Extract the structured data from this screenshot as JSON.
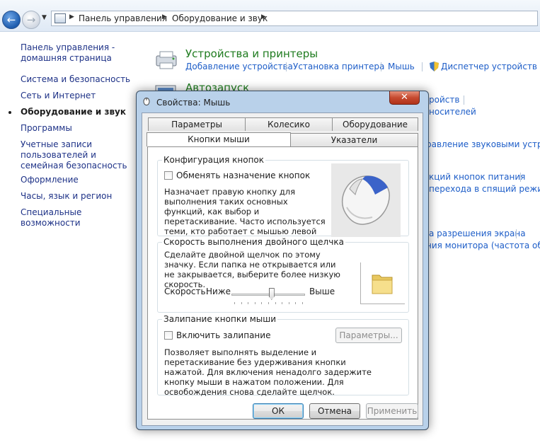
{
  "explorer": {
    "breadcrumb": [
      "Панель управления",
      "Оборудование и звук"
    ]
  },
  "leftnav": {
    "items": [
      "Панель управления - домашняя страница",
      "Система и безопасность",
      "Сеть и Интернет",
      "Оборудование и звук",
      "Программы",
      "Учетные записи пользователей и семейная безопасность",
      "Оформление",
      "Часы, язык и регион",
      "Специальные возможности"
    ],
    "current": "Оборудование и звук"
  },
  "content": {
    "devices": {
      "title": "Устройства и принтеры",
      "links": [
        "Добавление устройства",
        "Установка принтера",
        "Мышь",
        "Диспетчер устройств"
      ]
    },
    "autoplay": {
      "title": "Автозапуск",
      "partial_links": [
        "ройств",
        "носителей"
      ]
    },
    "partial_links": [
      "равление звуковыми устрой",
      "кций кнопок питания",
      "перехода в спящий режим",
      "а разрешения экрана",
      "ния монитора (частота обно"
    ]
  },
  "dialog": {
    "title": "Свойства: Мышь",
    "close_glyph": "✕",
    "tabs_row1": [
      "Параметры указателя",
      "Колесико",
      "Оборудование"
    ],
    "tabs_row2": [
      "Кнопки мыши",
      "Указатели"
    ],
    "active_tab": "Кнопки мыши",
    "button_config": {
      "title": "Конфигурация кнопок",
      "checkbox_label": "Обменять назначение кнопок",
      "checked": false,
      "description": "Назначает правую кнопку для выполнения таких основных функций, как выбор и перетаскивание. Часто используется теми, кто работает с мышью левой рукой."
    },
    "double_click": {
      "title": "Скорость выполнения двойного щелчка",
      "description": "Сделайте двойной щелчок по этому значку. Если папка не открывается или не закрывается, выберите более низкую скорость.",
      "speed_label": "Скорость:",
      "slow_label": "Ниже",
      "fast_label": "Выше",
      "speed_value": 0.55
    },
    "click_lock": {
      "title": "Залипание кнопки мыши",
      "checkbox_label": "Включить залипание",
      "checked": false,
      "settings_button": "Параметры...",
      "description": "Позволяет выполнять выделение и перетаскивание без удерживания кнопки нажатой. Для включения ненадолго задержите кнопку мыши в нажатом положении. Для освобождения снова сделайте щелчок."
    },
    "buttons": {
      "ok": "ОК",
      "cancel": "Отмена",
      "apply": "Применить"
    }
  }
}
